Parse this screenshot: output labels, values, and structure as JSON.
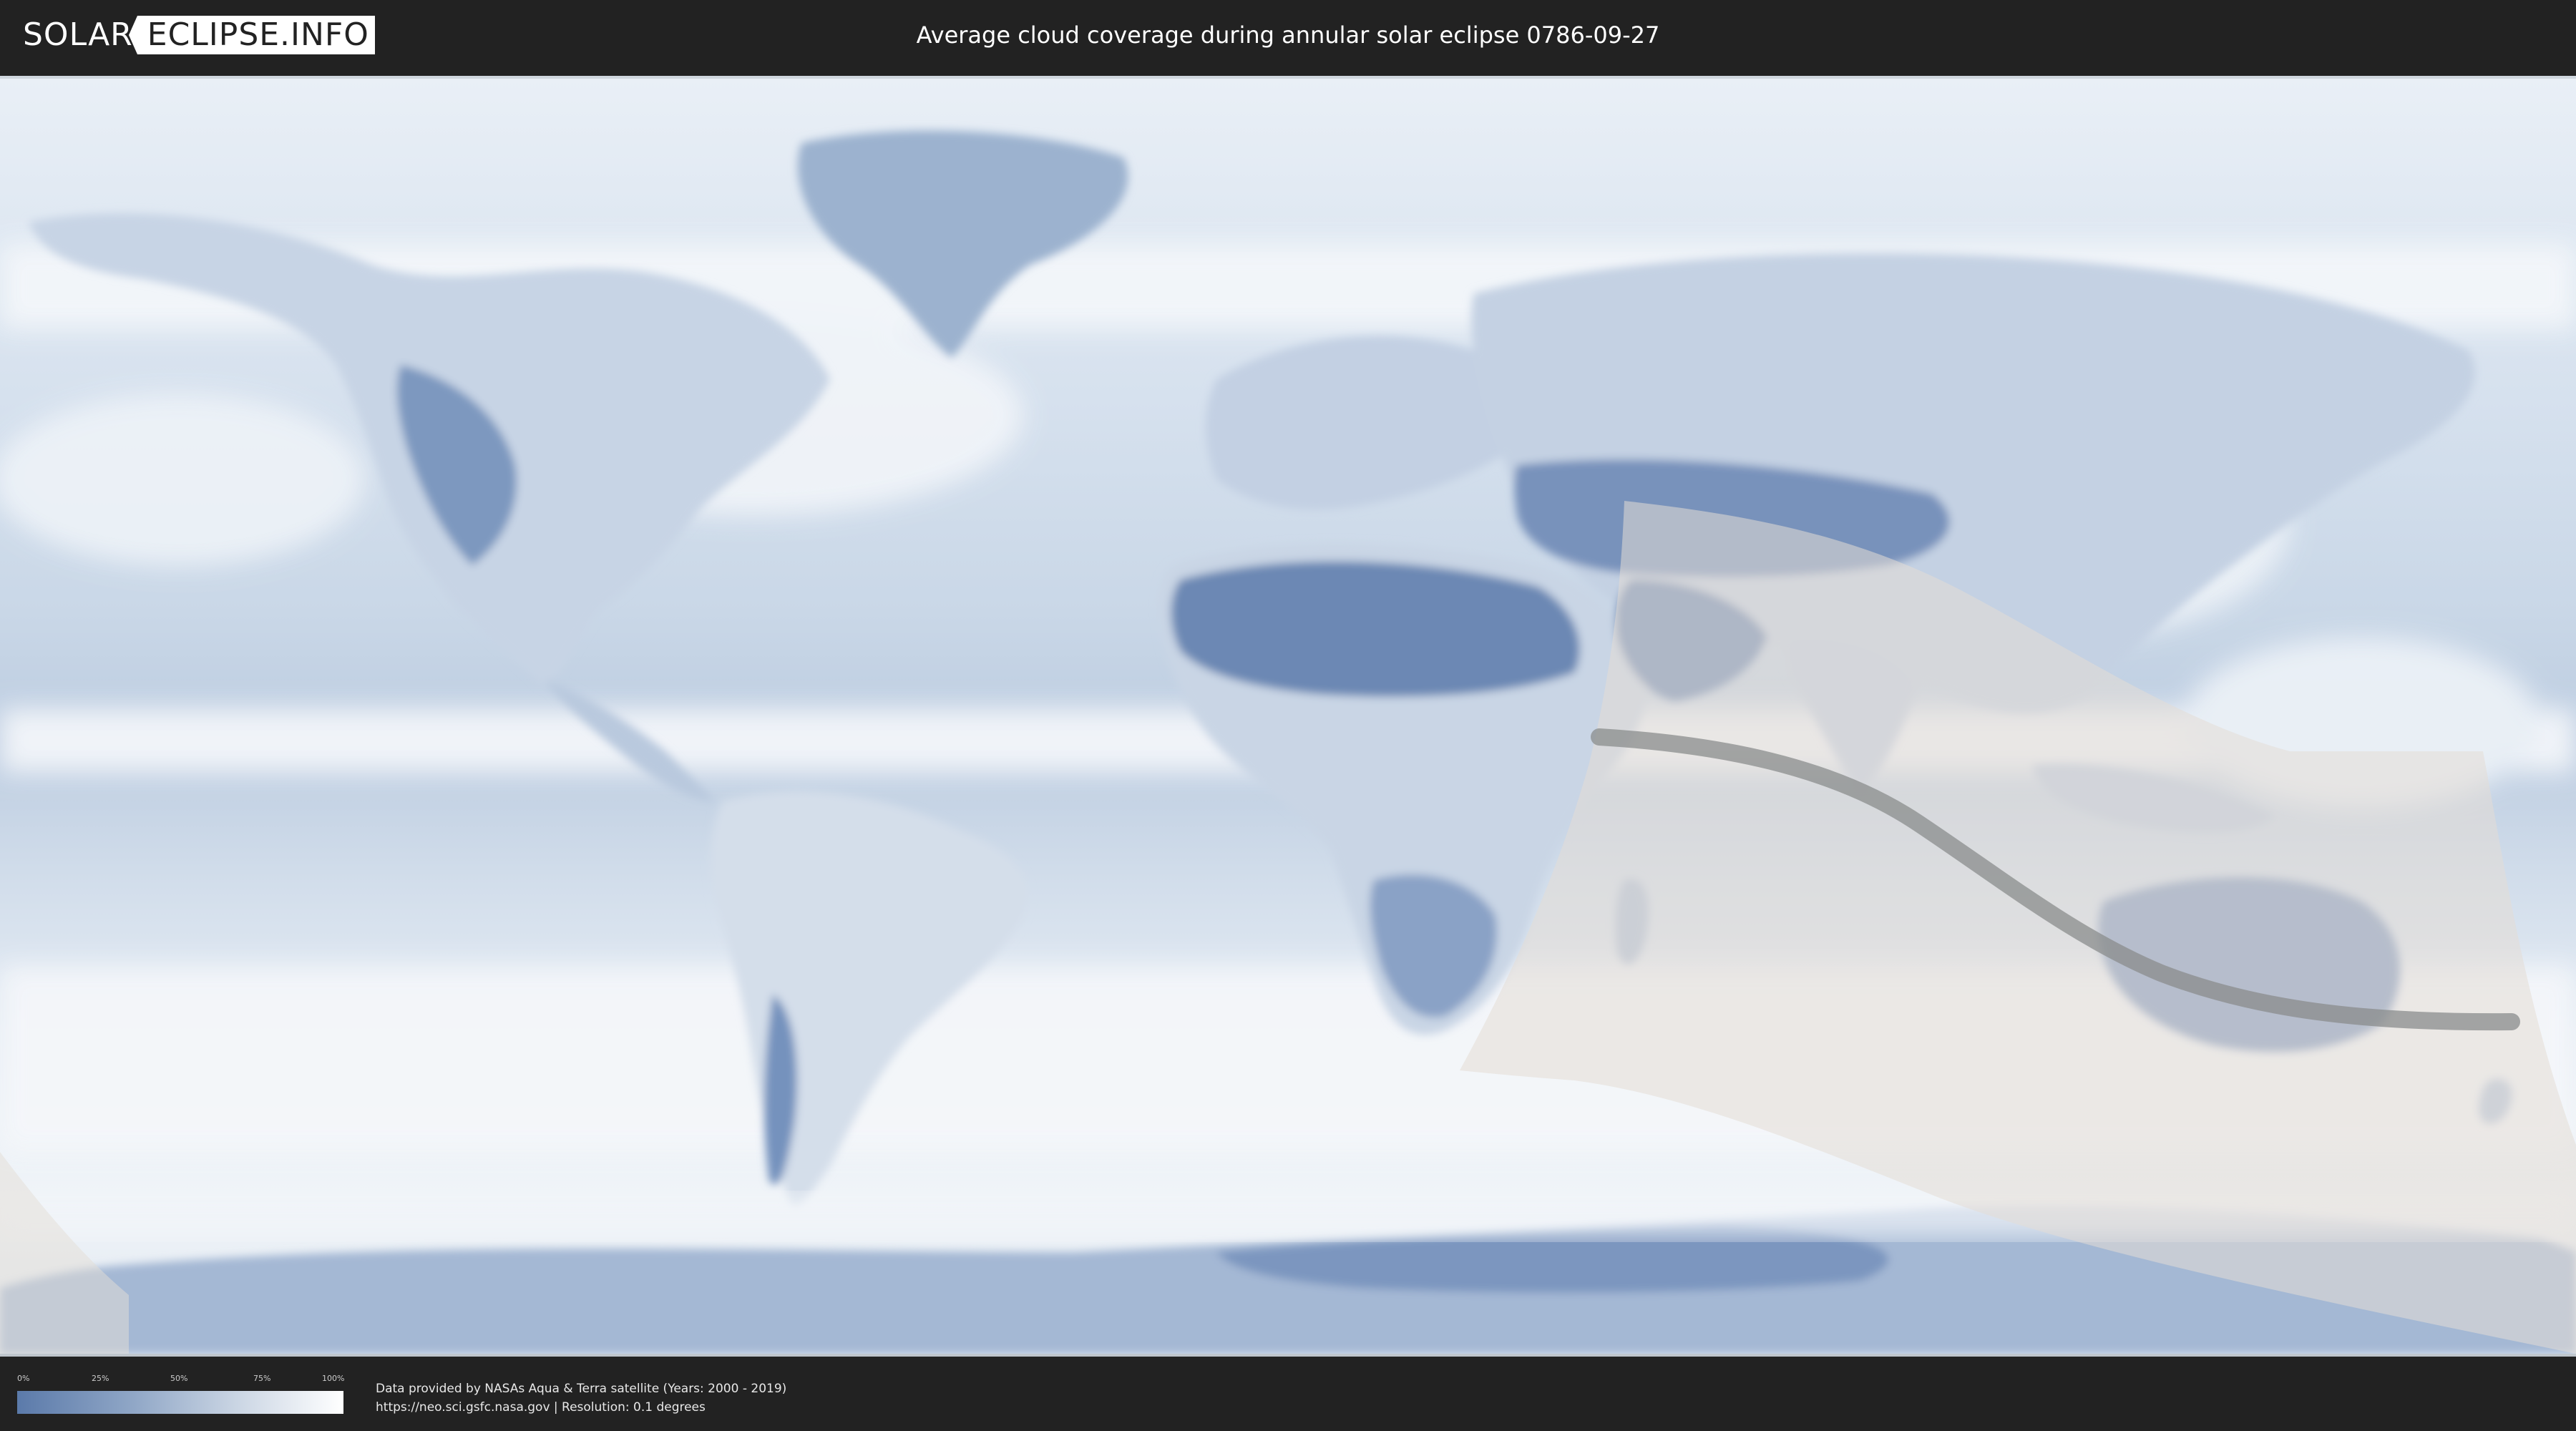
{
  "header": {
    "logo_left": "SOLAR",
    "logo_right": "ECLIPSE.INFO",
    "title": "Average cloud coverage during annular solar eclipse 0786-09-27"
  },
  "legend": {
    "ticks": [
      "0%",
      "25%",
      "50%",
      "75%",
      "100%"
    ],
    "color_low": "#5b7aaa",
    "color_high": "#ffffff"
  },
  "footer": {
    "credit": "Data provided by NASAs Aqua & Terra satellite (Years: 2000 - 2019)",
    "source": "https://neo.sci.gsfc.nasa.gov | Resolution: 0.1 degrees"
  },
  "colors": {
    "background": "#222222",
    "cloud_light": "#eef3f8",
    "clear_sky": "#6d8bb6",
    "eclipse_zone": "#d9d4cc",
    "central_path": "#8a8c8c"
  }
}
